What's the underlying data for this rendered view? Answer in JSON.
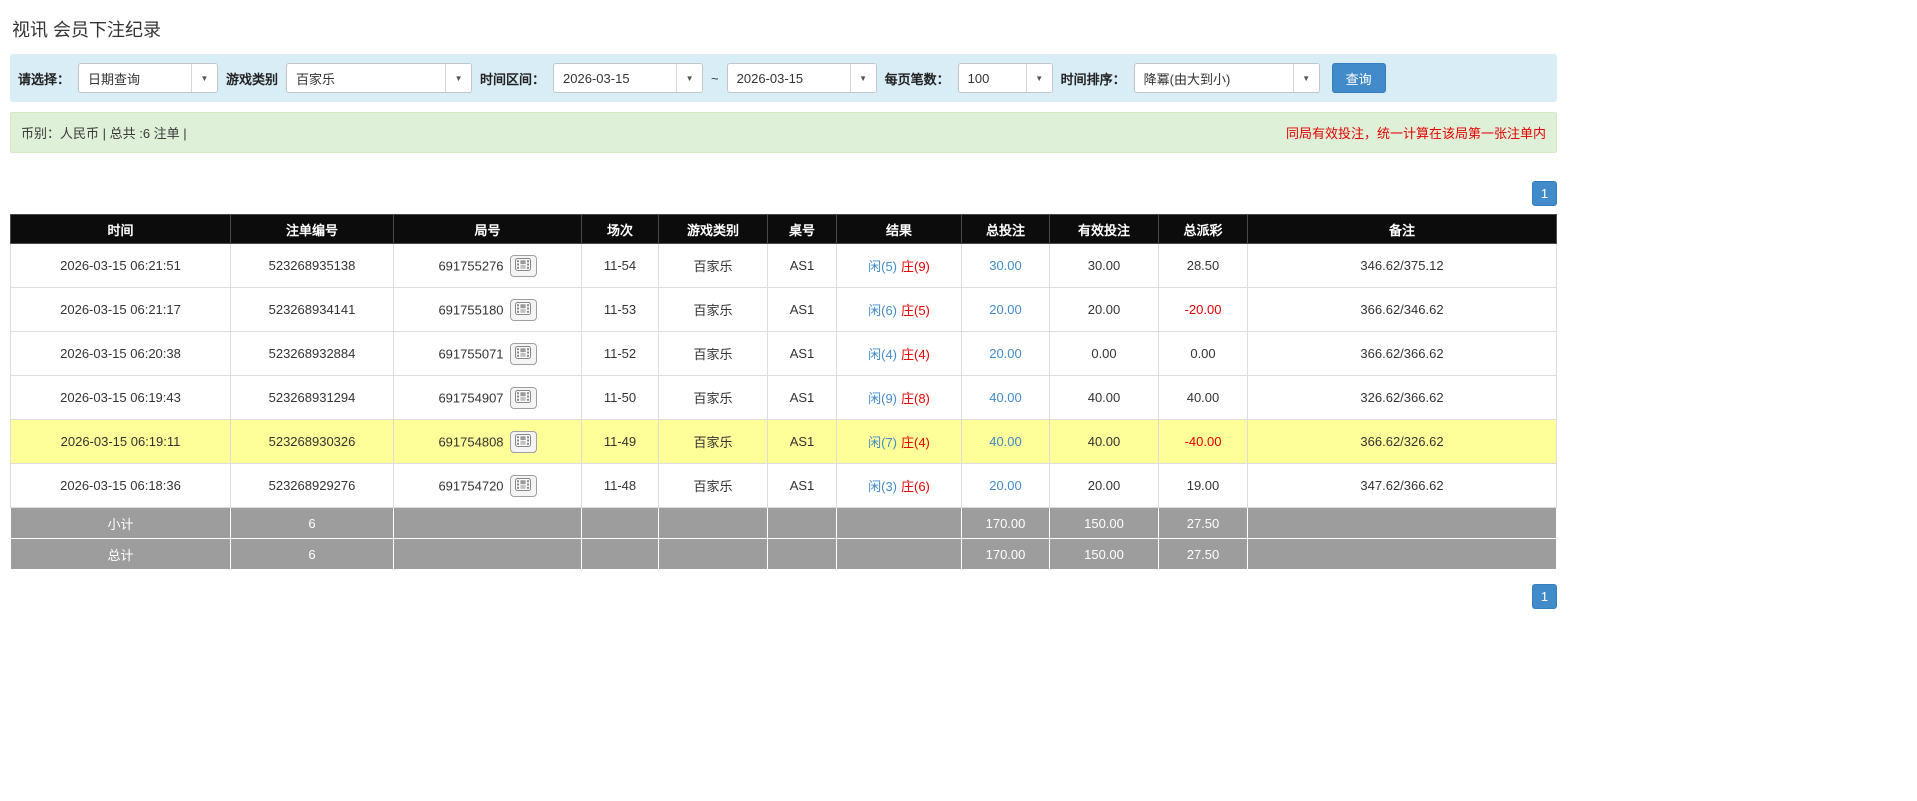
{
  "colors": {
    "accent_blue": "#428bca",
    "negative_red": "#e60000",
    "player_blue": "#428bca",
    "banker_red": "#e60000",
    "highlight_yellow": "#ffff99",
    "table_header_black": "#0c0c0c",
    "summary_gray": "#9d9d9d",
    "filter_bar_bg": "#d9edf7",
    "info_bar_bg": "#dff0d8"
  },
  "icons": {
    "chevron_down": "▼"
  },
  "page": {
    "title": "视讯 会员下注纪录"
  },
  "filters": {
    "select_label": "请选择：",
    "select_value": "日期查询",
    "game_label": "游戏类别",
    "game_value": "百家乐",
    "range_label": "时间区间：",
    "date_from": "2026-03-15",
    "separator": "~",
    "date_to": "2026-03-15",
    "page_size_label": "每页笔数：",
    "page_size_value": "100",
    "sort_label": "时间排序：",
    "sort_value": "降冪(由大到小)",
    "search_button": "查询"
  },
  "info_bar": {
    "summary": "币别：人民币 | 总共 :6 注单 |",
    "notice": "同局有效投注，统一计算在该局第一张注单内"
  },
  "pagination": {
    "current_page": "1"
  },
  "table": {
    "headers": [
      "时间",
      "注单编号",
      "局号",
      "场次",
      "游戏类别",
      "桌号",
      "结果",
      "总投注",
      "有效投注",
      "总派彩",
      "备注"
    ],
    "rows": [
      {
        "time": "2026-03-15 06:21:51",
        "bet_id": "523268935138",
        "round": "691755276",
        "session": "11-54",
        "game": "百家乐",
        "table_no": "AS1",
        "player": "闲(5)",
        "banker": "庄(9)",
        "total_bet": "30.00",
        "valid_bet": "30.00",
        "payout": "28.50",
        "note": "346.62/375.12",
        "highlighted": false
      },
      {
        "time": "2026-03-15 06:21:17",
        "bet_id": "523268934141",
        "round": "691755180",
        "session": "11-53",
        "game": "百家乐",
        "table_no": "AS1",
        "player": "闲(6)",
        "banker": "庄(5)",
        "total_bet": "20.00",
        "valid_bet": "20.00",
        "payout": "-20.00",
        "note": "366.62/346.62",
        "highlighted": false
      },
      {
        "time": "2026-03-15 06:20:38",
        "bet_id": "523268932884",
        "round": "691755071",
        "session": "11-52",
        "game": "百家乐",
        "table_no": "AS1",
        "player": "闲(4)",
        "banker": "庄(4)",
        "total_bet": "20.00",
        "valid_bet": "0.00",
        "payout": "0.00",
        "note": "366.62/366.62",
        "highlighted": false
      },
      {
        "time": "2026-03-15 06:19:43",
        "bet_id": "523268931294",
        "round": "691754907",
        "session": "11-50",
        "game": "百家乐",
        "table_no": "AS1",
        "player": "闲(9)",
        "banker": "庄(8)",
        "total_bet": "40.00",
        "valid_bet": "40.00",
        "payout": "40.00",
        "note": "326.62/366.62",
        "highlighted": false
      },
      {
        "time": "2026-03-15 06:19:11",
        "bet_id": "523268930326",
        "round": "691754808",
        "session": "11-49",
        "game": "百家乐",
        "table_no": "AS1",
        "player": "闲(7)",
        "banker": "庄(4)",
        "total_bet": "40.00",
        "valid_bet": "40.00",
        "payout": "-40.00",
        "note": "366.62/326.62",
        "highlighted": true
      },
      {
        "time": "2026-03-15 06:18:36",
        "bet_id": "523268929276",
        "round": "691754720",
        "session": "11-48",
        "game": "百家乐",
        "table_no": "AS1",
        "player": "闲(3)",
        "banker": "庄(6)",
        "total_bet": "20.00",
        "valid_bet": "20.00",
        "payout": "19.00",
        "note": "347.62/366.62",
        "highlighted": false
      }
    ],
    "subtotal": {
      "label": "小计",
      "count": "6",
      "total_bet": "170.00",
      "valid_bet": "150.00",
      "payout": "27.50"
    },
    "total": {
      "label": "总计",
      "count": "6",
      "total_bet": "170.00",
      "valid_bet": "150.00",
      "payout": "27.50"
    }
  }
}
